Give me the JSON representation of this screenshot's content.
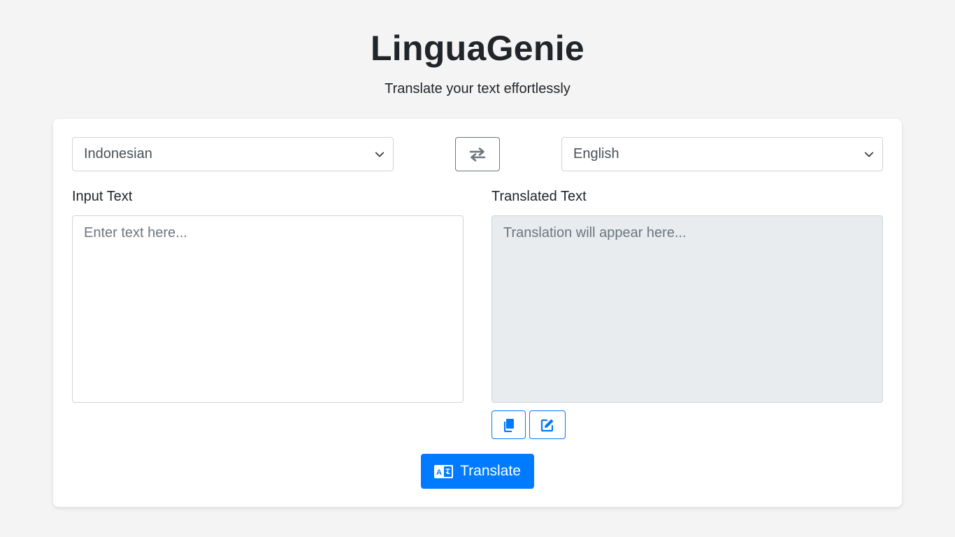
{
  "header": {
    "title": "LinguaGenie",
    "subtitle": "Translate your text effortlessly"
  },
  "languages": {
    "source_selected": "Indonesian",
    "target_selected": "English",
    "swap_icon": "swap-arrows-icon"
  },
  "input": {
    "label": "Input Text",
    "placeholder": "Enter text here...",
    "value": ""
  },
  "output": {
    "label": "Translated Text",
    "placeholder": "Translation will appear here...",
    "value": ""
  },
  "actions": {
    "copy_icon": "copy-icon",
    "edit_icon": "edit-icon",
    "translate_label": "Translate",
    "translate_icon": "translate-icon"
  },
  "colors": {
    "background": "#f4f4f4",
    "accent": "#007bff",
    "output_bg": "#e9ecef",
    "border": "#ced4da",
    "swap_border": "#6c757d"
  }
}
